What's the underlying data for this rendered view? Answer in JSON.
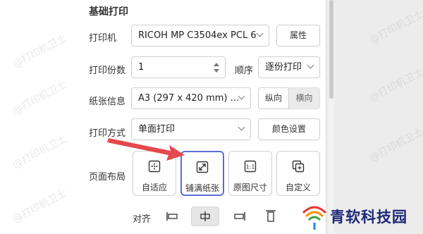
{
  "section_title": "基础打印",
  "printer": {
    "label": "打印机",
    "value": "RICOH MP C3504ex PCL 6",
    "properties_button": "属性"
  },
  "copies": {
    "label": "打印份数",
    "value": "1"
  },
  "order": {
    "label": "顺序",
    "value": "逐份打印"
  },
  "paper": {
    "label": "纸张信息",
    "value": "A3 (297 x 420 mm) ...",
    "portrait": "纵向",
    "landscape": "横向"
  },
  "print_mode": {
    "label": "打印方式",
    "value": "单面打印",
    "color_button": "颜色设置"
  },
  "page_layout": {
    "label": "页面布局",
    "options": [
      {
        "label": "自适应",
        "icon": "fit-icon"
      },
      {
        "label": "铺满纸张",
        "icon": "fill-paper-icon"
      },
      {
        "label": "原图尺寸",
        "icon": "actual-size-icon"
      },
      {
        "label": "自定义",
        "icon": "custom-icon"
      }
    ],
    "selected": "铺满纸张"
  },
  "align": {
    "label": "对齐",
    "selected": "center"
  },
  "watermark_text": "@打印机卫士",
  "brand": {
    "text": "青软科技园"
  },
  "colors": {
    "accent": "#5b6fd6",
    "arrow": "#e5484d",
    "brand_text": "#1e2a78"
  }
}
